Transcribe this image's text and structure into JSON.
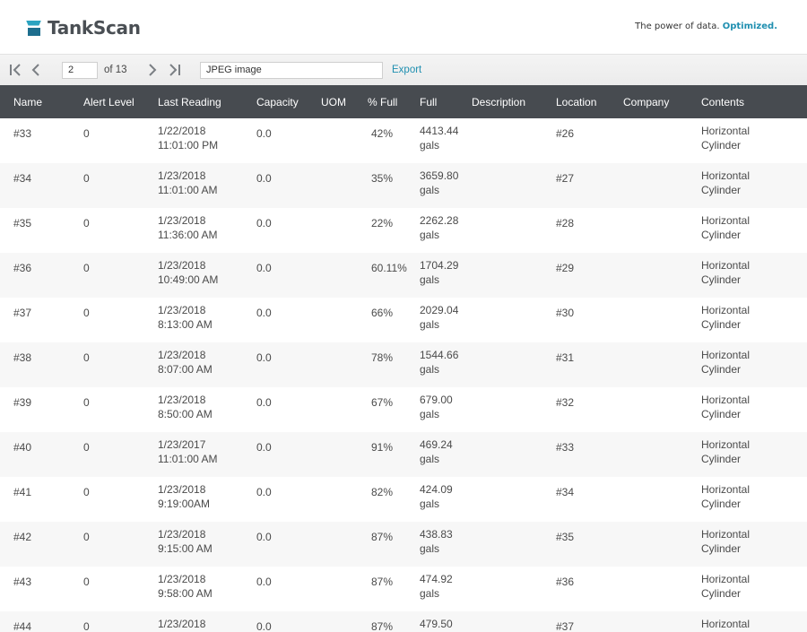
{
  "brand": {
    "name": "TankScan",
    "tagline": "The power of data.",
    "tagline_accent": "Optimized.",
    "accent_color": "#1f8fb0"
  },
  "toolbar": {
    "page_value": "2",
    "page_of": "of 13",
    "format_value": "JPEG image",
    "export_label": "Export",
    "icons": [
      "first-page-icon",
      "prev-page-icon",
      "next-page-icon",
      "last-page-icon"
    ]
  },
  "table": {
    "columns": [
      "Name",
      "Alert Level",
      "Last Reading",
      "Capacity",
      "UOM",
      "% Full",
      "Full",
      "Description",
      "Location",
      "Company",
      "Contents"
    ],
    "rows": [
      {
        "name": "#33",
        "alert": "0",
        "date": "1/22/2018",
        "time": "11:01:00 PM",
        "capacity": "0.0",
        "uom": "",
        "pct": "42%",
        "full": "4413.44",
        "full_unit": "gals",
        "description": "",
        "location": "#26",
        "company": "",
        "contents1": "Horizontal",
        "contents2": "Cylinder"
      },
      {
        "name": "#34",
        "alert": "0",
        "date": "1/23/2018",
        "time": "11:01:00 AM",
        "capacity": "0.0",
        "uom": "",
        "pct": "35%",
        "full": "3659.80",
        "full_unit": "gals",
        "description": "",
        "location": "#27",
        "company": "",
        "contents1": "Horizontal",
        "contents2": "Cylinder"
      },
      {
        "name": "#35",
        "alert": "0",
        "date": "1/23/2018",
        "time": "11:36:00 AM",
        "capacity": "0.0",
        "uom": "",
        "pct": "22%",
        "full": "2262.28",
        "full_unit": "gals",
        "description": "",
        "location": "#28",
        "company": "",
        "contents1": "Horizontal",
        "contents2": "Cylinder"
      },
      {
        "name": "#36",
        "alert": "0",
        "date": "1/23/2018",
        "time": "10:49:00 AM",
        "capacity": "0.0",
        "uom": "",
        "pct": "60.11%",
        "full": "1704.29",
        "full_unit": "gals",
        "description": "",
        "location": "#29",
        "company": "",
        "contents1": "Horizontal",
        "contents2": "Cylinder"
      },
      {
        "name": "#37",
        "alert": "0",
        "date": "1/23/2018",
        "time": "8:13:00 AM",
        "capacity": "0.0",
        "uom": "",
        "pct": "66%",
        "full": "2029.04",
        "full_unit": "gals",
        "description": "",
        "location": "#30",
        "company": "",
        "contents1": "Horizontal",
        "contents2": "Cylinder"
      },
      {
        "name": "#38",
        "alert": "0",
        "date": "1/23/2018",
        "time": "8:07:00 AM",
        "capacity": "0.0",
        "uom": "",
        "pct": "78%",
        "full": "1544.66",
        "full_unit": "gals",
        "description": "",
        "location": "#31",
        "company": "",
        "contents1": "Horizontal",
        "contents2": "Cylinder"
      },
      {
        "name": "#39",
        "alert": "0",
        "date": "1/23/2018",
        "time": "8:50:00 AM",
        "capacity": "0.0",
        "uom": "",
        "pct": "67%",
        "full": "679.00",
        "full_unit": "gals",
        "description": "",
        "location": "#32",
        "company": "",
        "contents1": "Horizontal",
        "contents2": "Cylinder"
      },
      {
        "name": "#40",
        "alert": "0",
        "date": "1/23/2017",
        "time": "11:01:00 AM",
        "capacity": "0.0",
        "uom": "",
        "pct": "91%",
        "full": "469.24",
        "full_unit": "gals",
        "description": "",
        "location": "#33",
        "company": "",
        "contents1": "Horizontal",
        "contents2": "Cylinder"
      },
      {
        "name": "#41",
        "alert": "0",
        "date": "1/23/2018",
        "time": "9:19:00AM",
        "capacity": "0.0",
        "uom": "",
        "pct": "82%",
        "full": "424.09",
        "full_unit": "gals",
        "description": "",
        "location": "#34",
        "company": "",
        "contents1": "Horizontal",
        "contents2": "Cylinder"
      },
      {
        "name": "#42",
        "alert": "0",
        "date": "1/23/2018",
        "time": "9:15:00 AM",
        "capacity": "0.0",
        "uom": "",
        "pct": "87%",
        "full": "438.83",
        "full_unit": "gals",
        "description": "",
        "location": "#35",
        "company": "",
        "contents1": "Horizontal",
        "contents2": "Cylinder"
      },
      {
        "name": "#43",
        "alert": "0",
        "date": "1/23/2018",
        "time": "9:58:00 AM",
        "capacity": "0.0",
        "uom": "",
        "pct": "87%",
        "full": "474.92",
        "full_unit": "gals",
        "description": "",
        "location": "#36",
        "company": "",
        "contents1": "Horizontal",
        "contents2": "Cylinder"
      },
      {
        "name": "#44",
        "alert": "0",
        "date": "1/23/2018",
        "time": "",
        "capacity": "0.0",
        "uom": "",
        "pct": "87%",
        "full": "479.50",
        "full_unit": "",
        "description": "",
        "location": "#37",
        "company": "",
        "contents1": "Horizontal",
        "contents2": ""
      }
    ]
  }
}
